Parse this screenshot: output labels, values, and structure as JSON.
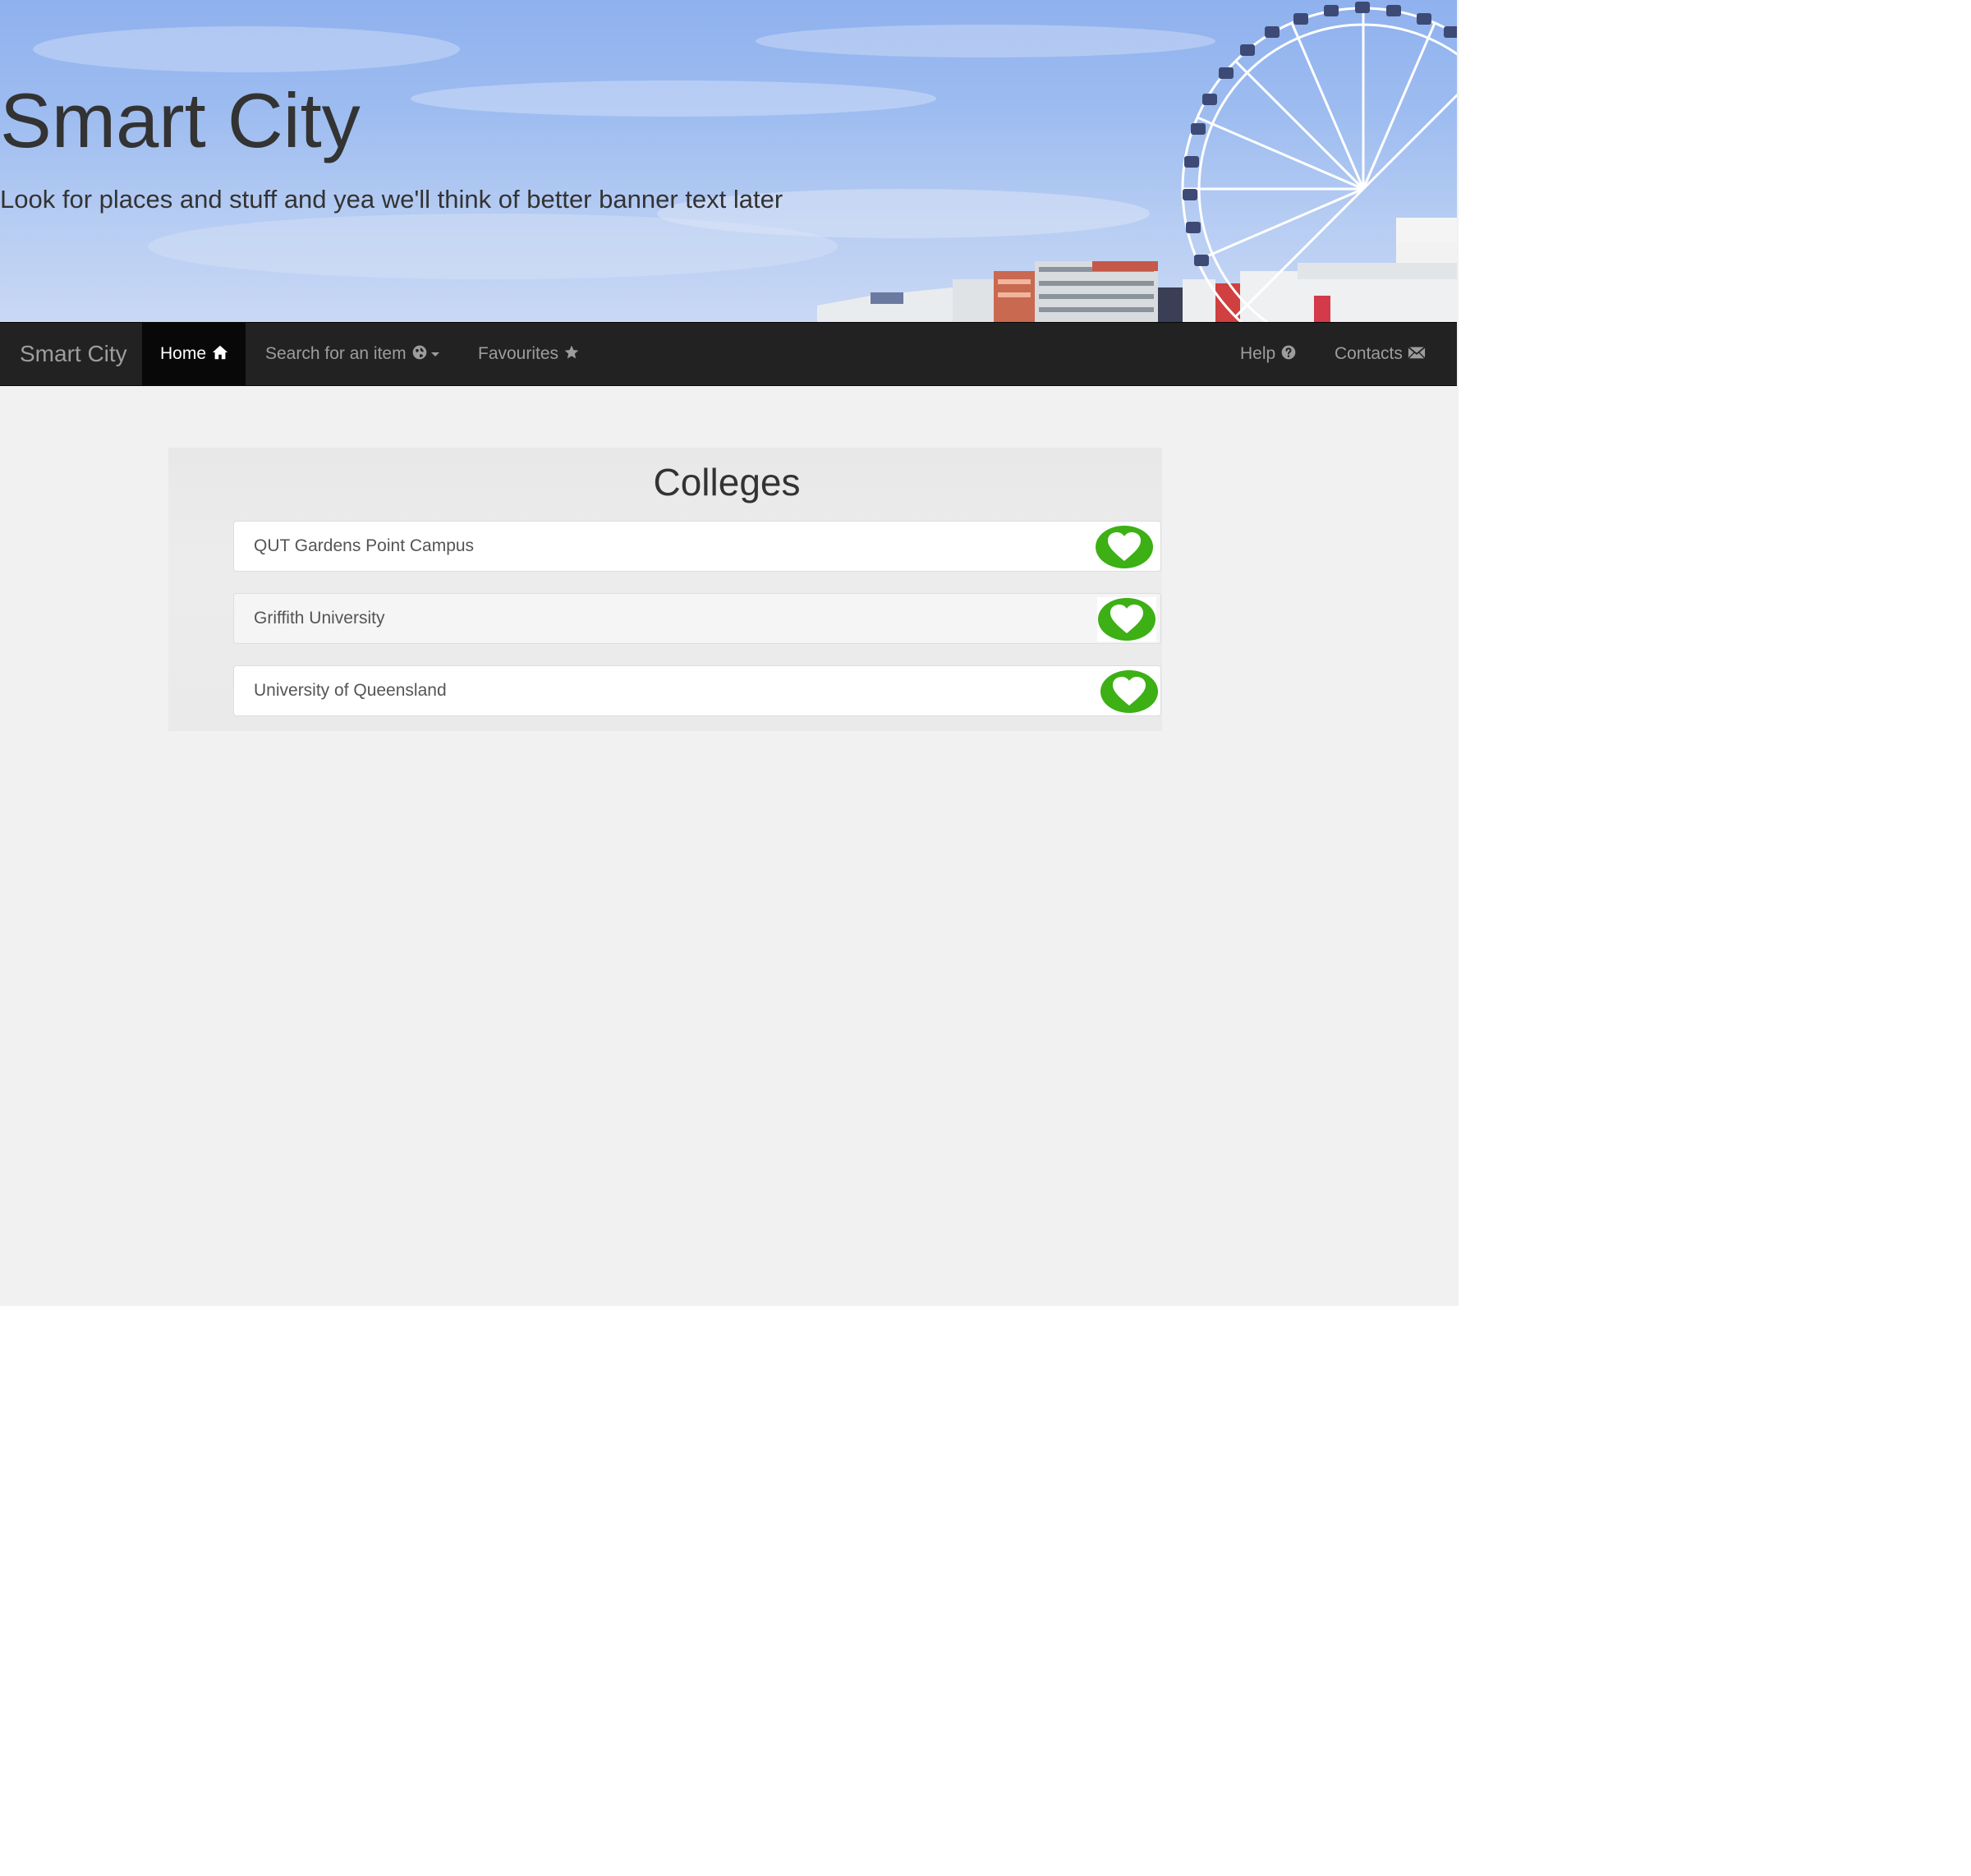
{
  "banner": {
    "title": "Smart City",
    "subtitle": "Look for places and stuff and yea we'll think of better banner text later"
  },
  "navbar": {
    "brand": "Smart City",
    "items": [
      {
        "label": "Home",
        "icon": "home-icon",
        "active": true
      },
      {
        "label": "Search for an item",
        "icon": "globe-icon",
        "dropdown": true
      },
      {
        "label": "Favourites",
        "icon": "star-icon"
      },
      {
        "label": "Help",
        "icon": "question-circle-icon"
      },
      {
        "label": "Contacts",
        "icon": "envelope-icon"
      }
    ]
  },
  "main": {
    "heading": "Colleges",
    "items": [
      {
        "label": "QUT Gardens Point Campus",
        "icon": "heart-icon"
      },
      {
        "label": "Griffith University",
        "icon": "heart-icon"
      },
      {
        "label": "University of Queensland",
        "icon": "heart-icon"
      }
    ]
  },
  "colors": {
    "navbar_bg": "#222222",
    "navbar_active": "#080808",
    "nav_text": "#9d9d9d",
    "favourite_green": "#3cb014",
    "page_bg": "#f1f1f1"
  }
}
